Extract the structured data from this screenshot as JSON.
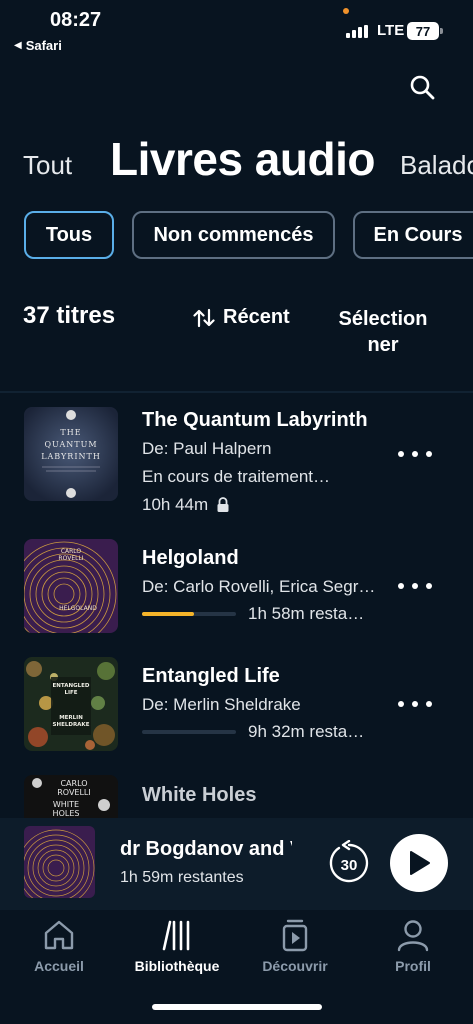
{
  "status_bar": {
    "time": "08:27",
    "back_app": "Safari",
    "network": "LTE",
    "battery": "77"
  },
  "categories": {
    "left": "Tout",
    "current": "Livres audio",
    "right": "Balado"
  },
  "filters": [
    {
      "label": "Tous",
      "active": true
    },
    {
      "label": "Non commencés",
      "active": false
    },
    {
      "label": "En Cours",
      "active": false
    }
  ],
  "toolbar": {
    "count": "37 titres",
    "sort_label": "Récent",
    "select_label": "Sélectionner"
  },
  "books": [
    {
      "title": "The Quantum Labyrinth",
      "author": "De: Paul Halpern",
      "status": "En cours de traitement…",
      "duration": "10h 44m",
      "cover_text": [
        "THE",
        "QUANTUM",
        "LABYRINTH"
      ]
    },
    {
      "title": "Helgoland",
      "author": "De: Carlo Rovelli, Erica Segr…",
      "remaining": "1h 58m resta…",
      "progress": 0.55,
      "cover_text": [
        "CARLO",
        "ROVELLI",
        "HELGOLAND"
      ]
    },
    {
      "title": "Entangled Life",
      "author": "De: Merlin Sheldrake",
      "remaining": "9h 32m resta…",
      "progress": 0.0,
      "cover_text": [
        "ENTANGLED",
        "LIFE",
        "MERLIN",
        "SHELDRAKE"
      ]
    },
    {
      "title": "White Holes",
      "cover_text": [
        "CARLO",
        "ROVELLI",
        "WHITE",
        "HOLES"
      ]
    }
  ],
  "player": {
    "title": "dr Bogdanov and V",
    "remaining": "1h 59m restantes",
    "skip_seconds": "30"
  },
  "nav": [
    {
      "label": "Accueil",
      "icon": "home-icon",
      "active": false
    },
    {
      "label": "Bibliothèque",
      "icon": "library-icon",
      "active": true
    },
    {
      "label": "Découvrir",
      "icon": "discover-icon",
      "active": false
    },
    {
      "label": "Profil",
      "icon": "profile-icon",
      "active": false
    }
  ],
  "colors": {
    "background": "#081420",
    "accent_chip": "#5aaee8",
    "progress": "#f5b42a"
  }
}
